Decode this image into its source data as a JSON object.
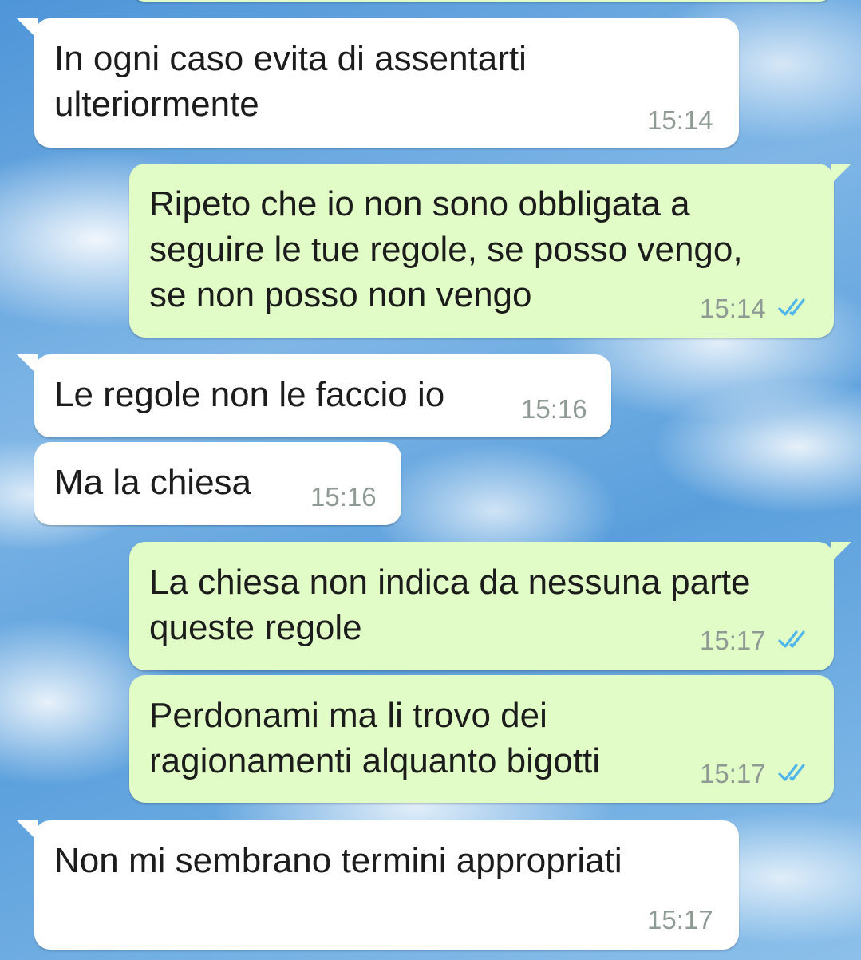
{
  "colors": {
    "incoming_bubble": "#ffffff",
    "outgoing_bubble": "#e1fcc6",
    "timestamp": "#8e9a93",
    "read_ticks": "#4fb6ec"
  },
  "messages": [
    {
      "direction": "incoming",
      "text": "In ogni caso evita di assentarti\nulteriormente",
      "time": "15:14"
    },
    {
      "direction": "outgoing",
      "text": "Ripeto che io non sono obbligata a\nseguire le tue regole, se posso vengo,\nse non posso non vengo",
      "time": "15:14",
      "status_icon": "double-check-read-icon"
    },
    {
      "direction": "incoming",
      "text": "Le regole non le faccio io",
      "time": "15:16"
    },
    {
      "direction": "incoming",
      "text": "Ma la chiesa",
      "time": "15:16"
    },
    {
      "direction": "outgoing",
      "text": "La chiesa non indica da nessuna parte\nqueste regole",
      "time": "15:17",
      "status_icon": "double-check-read-icon"
    },
    {
      "direction": "outgoing",
      "text": "Perdonami ma li trovo dei\nragionamenti alquanto bigotti",
      "time": "15:17",
      "status_icon": "double-check-read-icon"
    },
    {
      "direction": "incoming",
      "text": "Non mi sembrano termini appropriati",
      "time": "15:17"
    }
  ]
}
